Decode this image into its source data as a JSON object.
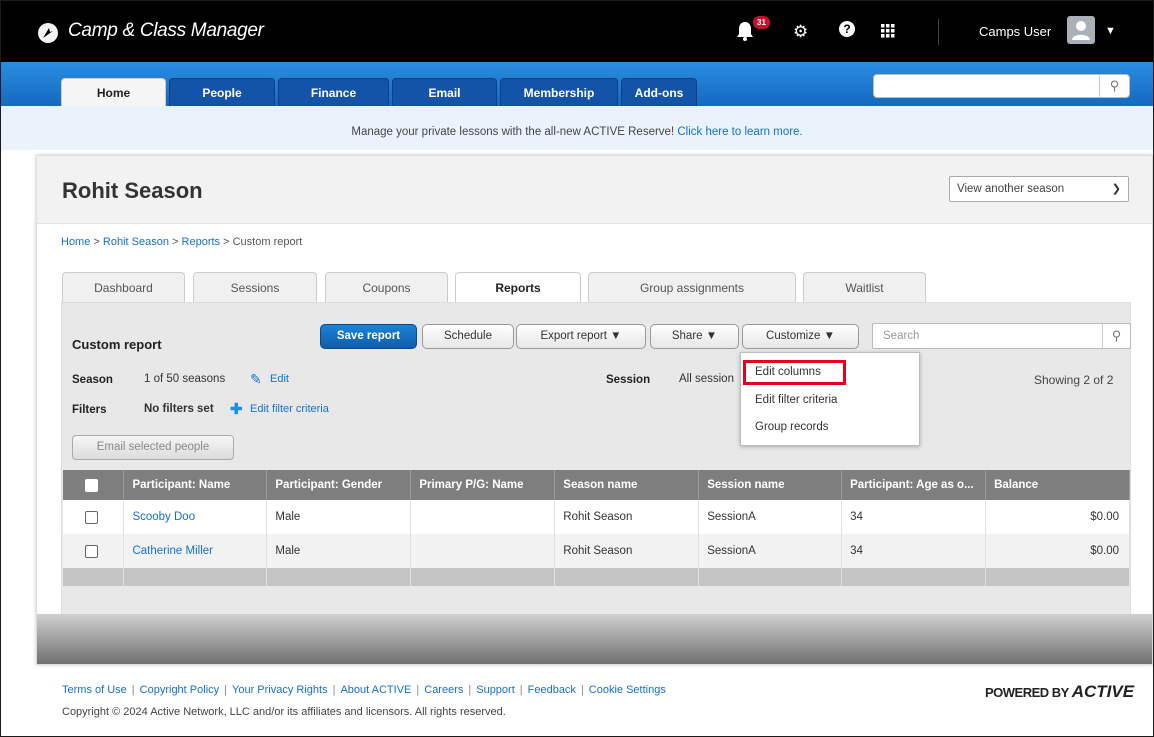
{
  "app": {
    "title": "Camp & Class Manager",
    "notification_count": "31",
    "user_name": "Camps User"
  },
  "nav": {
    "tabs": [
      {
        "label": "Home"
      },
      {
        "label": "People"
      },
      {
        "label": "Finance"
      },
      {
        "label": "Email"
      },
      {
        "label": "Membership"
      },
      {
        "label": "Add-ons"
      }
    ],
    "search_placeholder": ""
  },
  "promo": {
    "text": "Manage your private lessons with the all-new ACTIVE Reserve!",
    "link": "Click here to learn more."
  },
  "season": {
    "title": "Rohit Season",
    "select_label": "View another season"
  },
  "breadcrumb": {
    "home": "Home",
    "season": "Rohit Season",
    "reports": "Reports",
    "current": "Custom report",
    "sep": ">"
  },
  "subtabs": [
    {
      "label": "Dashboard"
    },
    {
      "label": "Sessions"
    },
    {
      "label": "Coupons"
    },
    {
      "label": "Reports"
    },
    {
      "label": "Group assignments"
    },
    {
      "label": "Waitlist"
    }
  ],
  "report": {
    "title": "Custom report",
    "buttons": {
      "save": "Save report",
      "schedule": "Schedule",
      "export": "Export report ▼",
      "share": "Share ▼",
      "customize": "Customize ▼"
    },
    "search_placeholder": "Search",
    "season_label": "Season",
    "season_value": "1 of 50 seasons",
    "edit_label": "Edit",
    "session_label": "Session",
    "session_value": "All session",
    "filters_label": "Filters",
    "filters_value": "No filters set",
    "edit_filter_label": "Edit filter criteria",
    "showing": "Showing 2 of 2",
    "email_button": "Email selected people"
  },
  "customize_menu": {
    "items": [
      "Edit columns",
      "Edit filter criteria",
      "Group records"
    ]
  },
  "table": {
    "headers": [
      "Participant: Name",
      "Participant: Gender",
      "Primary P/G: Name",
      "Season name",
      "Session name",
      "Participant: Age as o...",
      "Balance"
    ],
    "rows": [
      [
        "Scooby Doo",
        "Male",
        "",
        "Rohit Season",
        "SessionA",
        "34",
        "$0.00"
      ],
      [
        "Catherine Miller",
        "Male",
        "",
        "Rohit Season",
        "SessionA",
        "34",
        "$0.00"
      ]
    ]
  },
  "footer": {
    "links": [
      "Terms of Use",
      "Copyright Policy",
      "Your Privacy Rights",
      "About ACTIVE",
      "Careers",
      "Support",
      "Feedback",
      "Cookie Settings"
    ],
    "copyright": "Copyright © 2024 Active Network, LLC and/or its affiliates and licensors. All rights reserved.",
    "powered_prefix": "POWERED BY",
    "powered_brand": "ACTIVE"
  },
  "colors": {
    "nav_blue": "#1569c0",
    "link_blue": "#1570cc",
    "highlight_red": "#e3001b",
    "notif_red": "#c8102e"
  }
}
